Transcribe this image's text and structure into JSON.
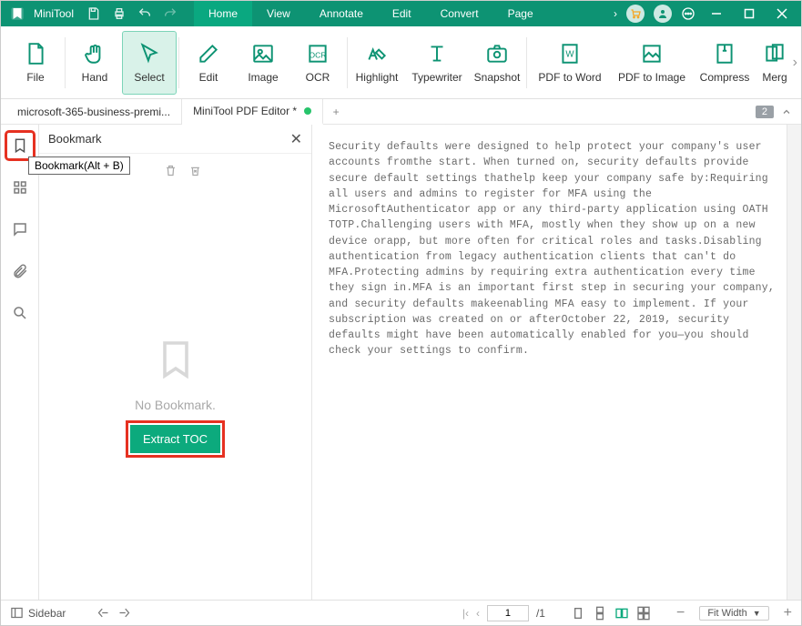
{
  "app": {
    "name": "MiniTool"
  },
  "menu": [
    "Home",
    "View",
    "Annotate",
    "Edit",
    "Convert",
    "Page"
  ],
  "menu_active": 0,
  "ribbon": {
    "file": "File",
    "hand": "Hand",
    "select": "Select",
    "edit": "Edit",
    "image": "Image",
    "ocr": "OCR",
    "highlight": "Highlight",
    "typewriter": "Typewriter",
    "snapshot": "Snapshot",
    "pdf2word": "PDF to Word",
    "pdf2image": "PDF to Image",
    "compress": "Compress",
    "merge": "Merg"
  },
  "tabs": {
    "t1": "microsoft-365-business-premi...",
    "t2": "MiniTool PDF Editor *"
  },
  "page_badge": "2",
  "tooltip": "Bookmark(Alt + B)",
  "panel": {
    "title": "Bookmark",
    "empty": "No Bookmark.",
    "extract": "Extract TOC"
  },
  "status": {
    "sidebar_label": "Sidebar",
    "page": "1",
    "pages": "/1",
    "fit": "Fit Width"
  },
  "doc_text": "Security defaults were designed to help protect your company's user accounts fromthe start. When turned on, security defaults provide secure default settings thathelp keep your company safe by:Requiring all users and admins to register for MFA using the MicrosoftAuthenticator app or any third-party application using OATH TOTP.Challenging users with MFA, mostly when they show up on a new device orapp, but more often for critical roles and tasks.Disabling authentication from legacy authentication clients that can't do MFA.Protecting admins by requiring extra authentication every time they sign in.MFA is an important first step in securing your company, and security defaults makeenabling MFA easy to implement. If your subscription was created on or afterOctober 22, 2019, security defaults might have been automatically enabled for you—you should check your settings to confirm."
}
